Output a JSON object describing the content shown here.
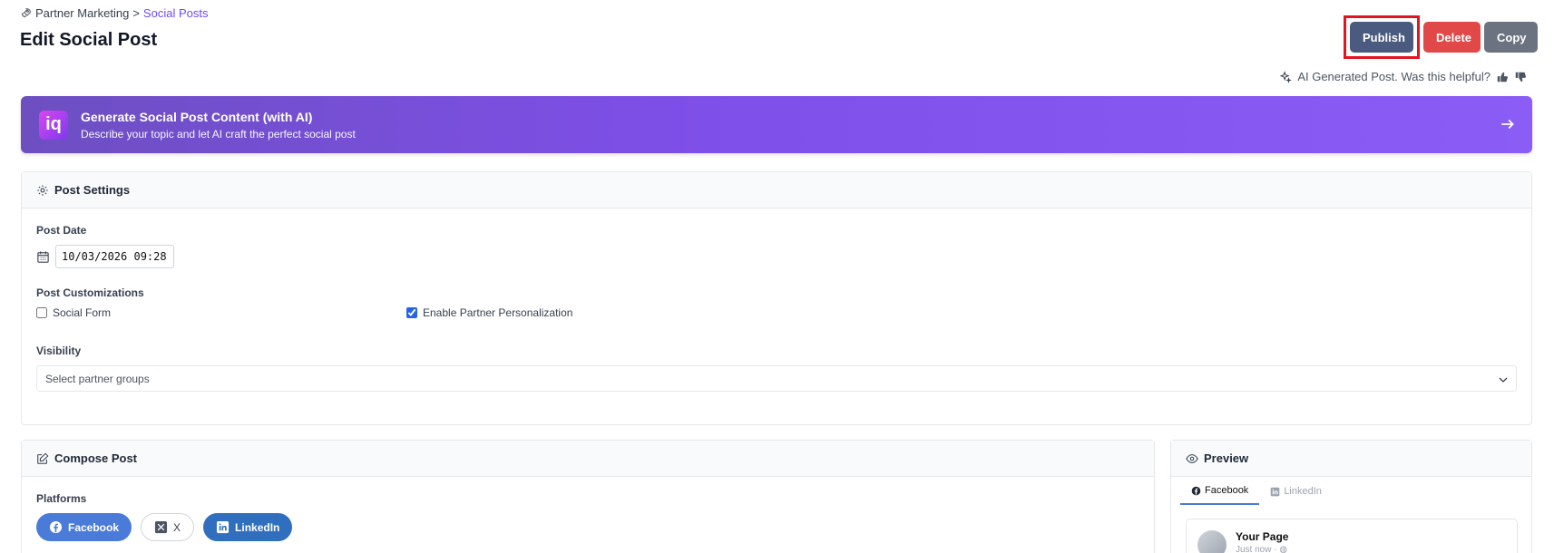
{
  "breadcrumb": {
    "parent": "Partner Marketing",
    "separator": ">",
    "current": "Social Posts"
  },
  "page_title": "Edit Social Post",
  "actions": {
    "publish": "Publish",
    "delete": "Delete",
    "copy": "Copy"
  },
  "ai_feedback": {
    "text": "AI Generated Post. Was this helpful?"
  },
  "ai_banner": {
    "logo_text": "iq",
    "title": "Generate Social Post Content (with AI)",
    "subtitle": "Describe your topic and let AI craft the perfect social post"
  },
  "settings": {
    "title": "Post Settings",
    "post_date_label": "Post Date",
    "post_date_value": "10/03/2026 09:28",
    "customizations_label": "Post Customizations",
    "social_form_label": "Social Form",
    "social_form_checked": false,
    "partner_personalization_label": "Enable Partner Personalization",
    "partner_personalization_checked": true,
    "visibility_label": "Visibility",
    "visibility_placeholder": "Select partner groups"
  },
  "compose": {
    "title": "Compose Post",
    "platforms_label": "Platforms",
    "platforms": [
      {
        "label": "Facebook",
        "selected": true
      },
      {
        "label": "X",
        "selected": false
      },
      {
        "label": "LinkedIn",
        "selected": true
      }
    ]
  },
  "preview": {
    "title": "Preview",
    "tabs": [
      "Facebook",
      "LinkedIn"
    ],
    "active_tab": "Facebook",
    "page_name": "Your Page",
    "post_time": "Just now · "
  },
  "colors": {
    "accent": "#6d4aff",
    "publish": "#4a5b7f",
    "delete": "#e14848",
    "copy": "#6b7280",
    "facebook": "#4a7bd8",
    "linkedin": "#2f6fbd"
  }
}
